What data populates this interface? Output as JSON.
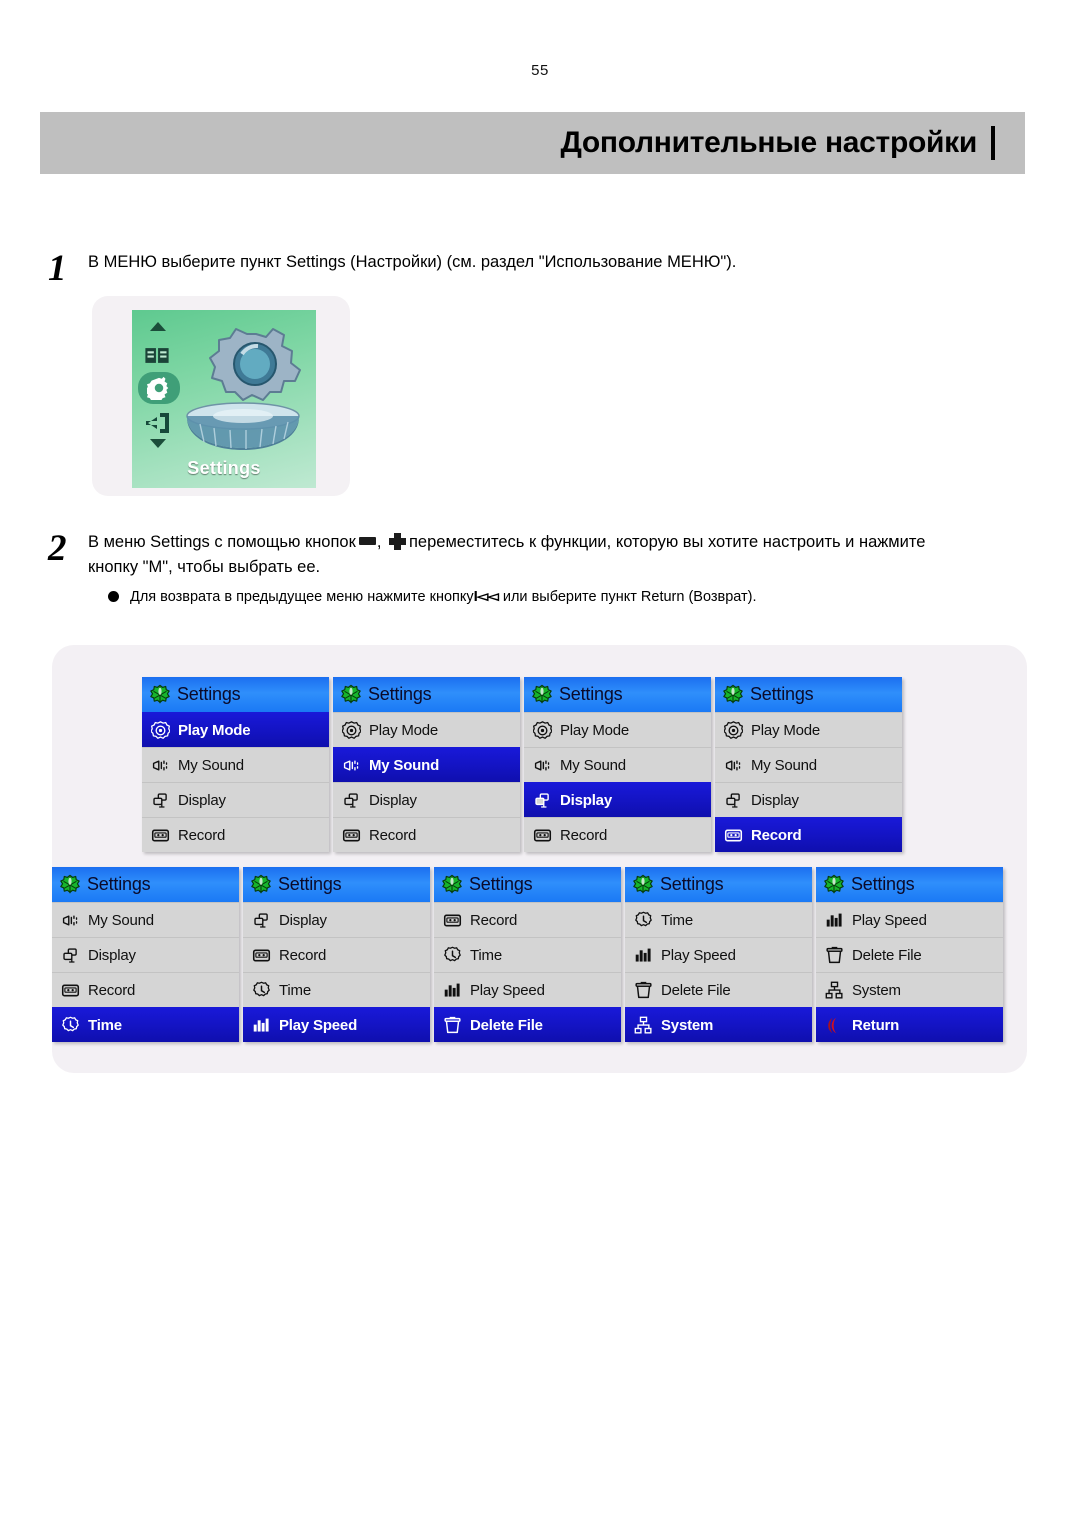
{
  "page": {
    "number": "55",
    "header_title": "Дополнительные настройки"
  },
  "steps": [
    {
      "number": "1",
      "text": "В МЕНЮ выберите пункт Settings (Настройки) (см. раздел \"Использование МЕНЮ\")."
    },
    {
      "number": "2",
      "text_part1": "В меню Settings с помощью кнопок",
      "text_part2": ", ",
      "text_part3": "переместитесь к функции, которую вы хотите настроить и нажмите",
      "text_line2": "кнопку \"M\", чтобы выбрать ее.",
      "bullet_part1": "Для возврата в предыдущее меню нажмите кнопку",
      "bullet_prev_glyph": "I◅◅",
      "bullet_part2": "или выберите пункт Return (Возврат)."
    }
  ],
  "device_shot": {
    "caption": "Settings",
    "icons": {
      "up_arrow": "up-arrow-icon",
      "book": "book-icon",
      "gear_selected": "gear-icon",
      "exit": "exit-icon",
      "down_arrow": "down-arrow-icon"
    }
  },
  "menu": {
    "title": "Settings",
    "items": {
      "play_mode": "Play Mode",
      "my_sound": "My Sound",
      "display": "Display",
      "record": "Record",
      "time": "Time",
      "play_speed": "Play Speed",
      "delete_file": "Delete File",
      "system": "System",
      "return": "Return"
    },
    "screens": [
      {
        "id": "screen-1",
        "title": "Settings",
        "rows": [
          {
            "label": "Play Mode",
            "icon": "play-mode-icon",
            "selected": true
          },
          {
            "label": "My Sound",
            "icon": "my-sound-icon",
            "selected": false
          },
          {
            "label": "Display",
            "icon": "display-icon",
            "selected": false
          },
          {
            "label": "Record",
            "icon": "record-icon",
            "selected": false
          }
        ]
      },
      {
        "id": "screen-2",
        "title": "Settings",
        "rows": [
          {
            "label": "Play Mode",
            "icon": "play-mode-icon",
            "selected": false
          },
          {
            "label": "My Sound",
            "icon": "my-sound-icon",
            "selected": true
          },
          {
            "label": "Display",
            "icon": "display-icon",
            "selected": false
          },
          {
            "label": "Record",
            "icon": "record-icon",
            "selected": false
          }
        ]
      },
      {
        "id": "screen-3",
        "title": "Settings",
        "rows": [
          {
            "label": "Play Mode",
            "icon": "play-mode-icon",
            "selected": false
          },
          {
            "label": "My Sound",
            "icon": "my-sound-icon",
            "selected": false
          },
          {
            "label": "Display",
            "icon": "display-icon",
            "selected": true
          },
          {
            "label": "Record",
            "icon": "record-icon",
            "selected": false
          }
        ]
      },
      {
        "id": "screen-4",
        "title": "Settings",
        "rows": [
          {
            "label": "Play Mode",
            "icon": "play-mode-icon",
            "selected": false
          },
          {
            "label": "My Sound",
            "icon": "my-sound-icon",
            "selected": false
          },
          {
            "label": "Display",
            "icon": "display-icon",
            "selected": false
          },
          {
            "label": "Record",
            "icon": "record-icon",
            "selected": true
          }
        ]
      },
      {
        "id": "screen-5",
        "title": "Settings",
        "rows": [
          {
            "label": "My Sound",
            "icon": "my-sound-icon",
            "selected": false
          },
          {
            "label": "Display",
            "icon": "display-icon",
            "selected": false
          },
          {
            "label": "Record",
            "icon": "record-icon",
            "selected": false
          },
          {
            "label": "Time",
            "icon": "time-icon",
            "selected": true
          }
        ]
      },
      {
        "id": "screen-6",
        "title": "Settings",
        "rows": [
          {
            "label": "Display",
            "icon": "display-icon",
            "selected": false
          },
          {
            "label": "Record",
            "icon": "record-icon",
            "selected": false
          },
          {
            "label": "Time",
            "icon": "time-icon",
            "selected": false
          },
          {
            "label": "Play Speed",
            "icon": "play-speed-icon",
            "selected": true
          }
        ]
      },
      {
        "id": "screen-7",
        "title": "Settings",
        "rows": [
          {
            "label": "Record",
            "icon": "record-icon",
            "selected": false
          },
          {
            "label": "Time",
            "icon": "time-icon",
            "selected": false
          },
          {
            "label": "Play Speed",
            "icon": "play-speed-icon",
            "selected": false
          },
          {
            "label": "Delete File",
            "icon": "delete-file-icon",
            "selected": true
          }
        ]
      },
      {
        "id": "screen-8",
        "title": "Settings",
        "rows": [
          {
            "label": "Time",
            "icon": "time-icon",
            "selected": false
          },
          {
            "label": "Play Speed",
            "icon": "play-speed-icon",
            "selected": false
          },
          {
            "label": "Delete File",
            "icon": "delete-file-icon",
            "selected": false
          },
          {
            "label": "System",
            "icon": "system-icon",
            "selected": true
          }
        ]
      },
      {
        "id": "screen-9",
        "title": "Settings",
        "rows": [
          {
            "label": "Play Speed",
            "icon": "play-speed-icon",
            "selected": false
          },
          {
            "label": "Delete File",
            "icon": "delete-file-icon",
            "selected": false
          },
          {
            "label": "System",
            "icon": "system-icon",
            "selected": false
          },
          {
            "label": "Return",
            "icon": "return-icon",
            "selected": true
          }
        ]
      }
    ]
  },
  "colors": {
    "header_band": "#bfbfbf",
    "panel_bg": "#f3f0f4",
    "lcd_title_blue": "#2f8ffb",
    "lcd_selected_blue": "#1414c4",
    "lcd_row_gray": "#d5d5d5",
    "device_lcd_green": "#7ed6a4"
  }
}
